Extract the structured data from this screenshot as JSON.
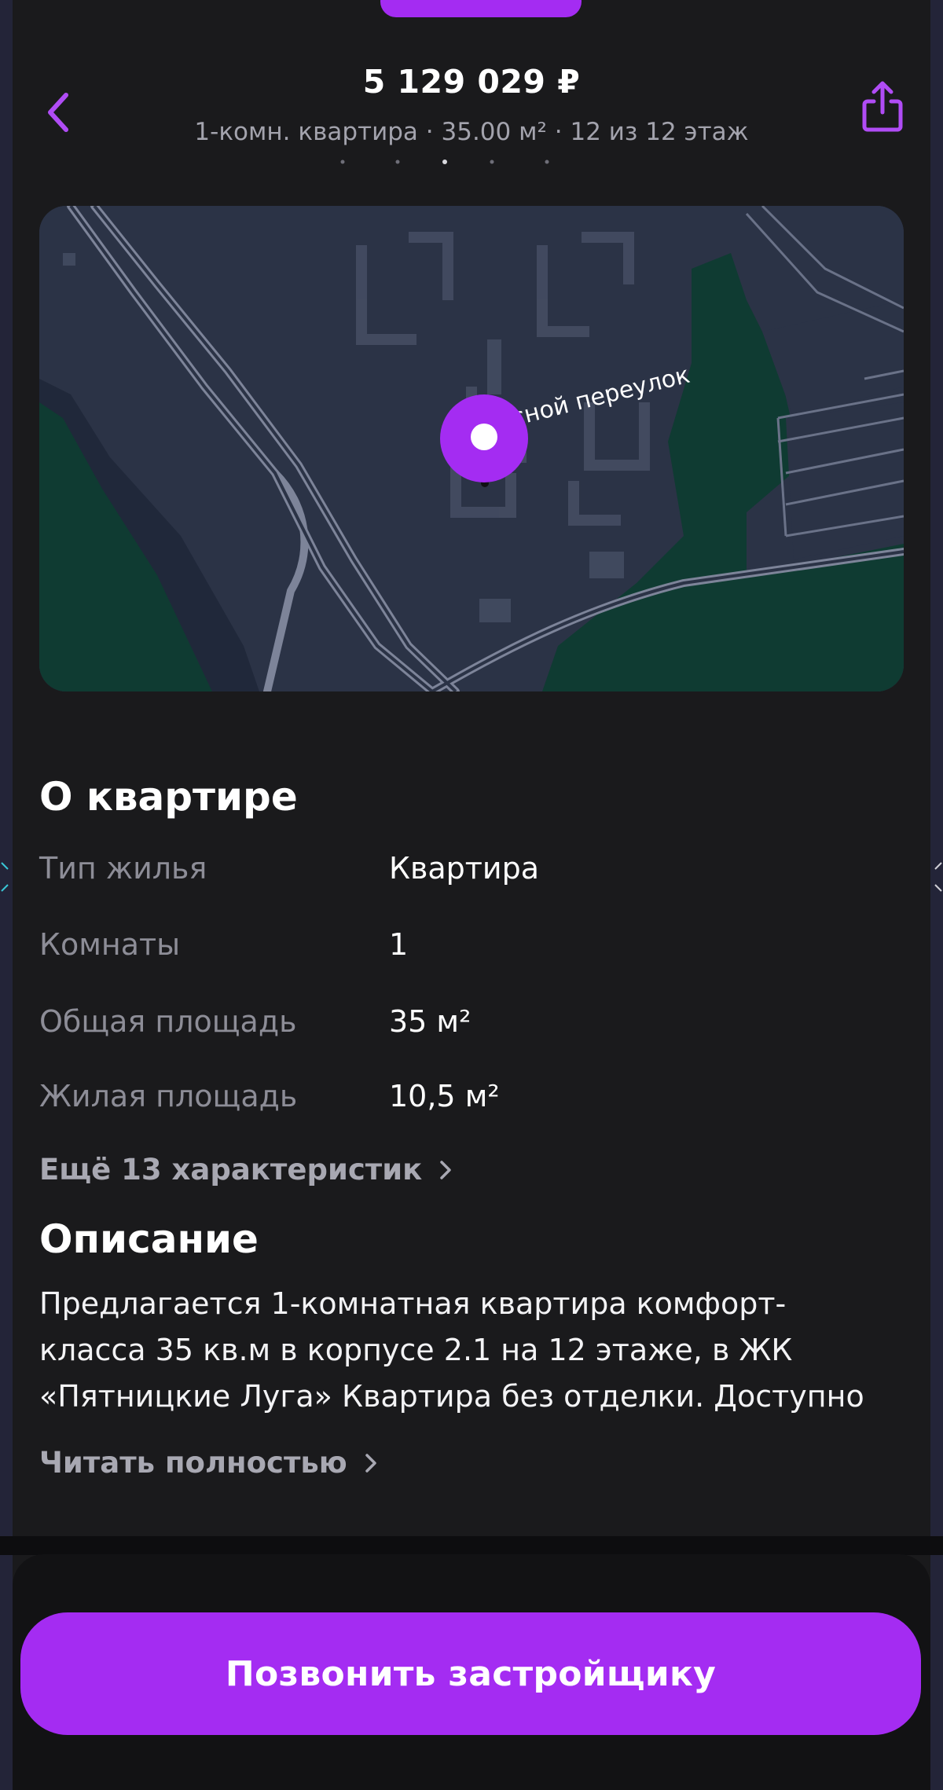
{
  "header": {
    "price": "5 129 029 ₽",
    "subtitle": "1-комн. квартира · 35.00 м² · 12 из 12 этаж"
  },
  "map": {
    "street_label": "Лесной переулок"
  },
  "about": {
    "title": "О квартире",
    "rows": [
      {
        "label": "Тип жилья",
        "value": "Квартира"
      },
      {
        "label": "Комнаты",
        "value": "1"
      },
      {
        "label": "Общая площадь",
        "value": "35 м²"
      },
      {
        "label": "Жилая площадь",
        "value": "10,5 м²"
      }
    ],
    "more_link": "Ещё 13 характеристик"
  },
  "description": {
    "title": "Описание",
    "lines": [
      "Предлагается 1-комнатная квартира комфорт-",
      "класса 35 кв.м в корпусе 2.1 на 12 этаже, в ЖК",
      "«Пятницкие Луга» Квартира без отделки. Доступно"
    ],
    "read_more": "Читать полностью"
  },
  "cta": {
    "call_label": "Позвонить застройщику"
  },
  "colors": {
    "accent": "#a42cf2",
    "background": "#1a1a1c",
    "map_base": "#2b3346",
    "map_green": "#0f3b32"
  },
  "icons": {
    "back": "chevron-left-icon",
    "share": "share-icon",
    "map_pin": "map-pin-icon",
    "link_chevron": "chevron-right-icon"
  }
}
